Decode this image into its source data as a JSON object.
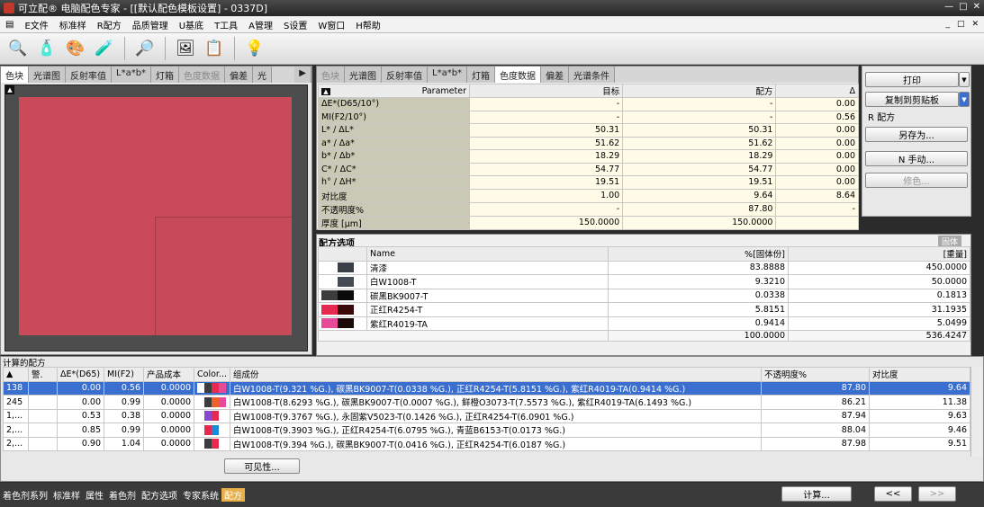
{
  "window": {
    "title": "可立配® 电脑配色专家 - [[默认配色模板设置] - 0337D]",
    "controls": [
      "—",
      "□",
      "✕"
    ]
  },
  "menu": {
    "items": [
      "E文件",
      "标准样",
      "R配方",
      "品质管理",
      "U基底",
      "T工具",
      "A管理",
      "S设置",
      "W窗口",
      "H帮助"
    ],
    "mdi": [
      "_",
      "□",
      "✕"
    ]
  },
  "toolbar": {
    "icons": [
      "🔍",
      "🧴",
      "🎨",
      "🧪",
      "🔎",
      "🖼",
      "📋",
      "💡"
    ]
  },
  "left_panel": {
    "tabs": [
      "色块",
      "光谱图",
      "反射率值",
      "L*a*b*",
      "灯箱",
      "色度数据",
      "偏差",
      "光"
    ],
    "active": 0,
    "colors": {
      "target": "#cb4a59",
      "recipe": "#c74a58",
      "background": "#4d4d4d"
    }
  },
  "param_panel": {
    "tabs": [
      "色块",
      "光谱图",
      "反射率值",
      "L*a*b*",
      "灯箱",
      "色度数据",
      "偏差",
      "光谱条件"
    ],
    "active": 5,
    "headers": [
      "Parameter",
      "目标",
      "配方",
      "Δ"
    ],
    "rows": [
      [
        "ΔE*(D65/10°)",
        "-",
        "-",
        "0.00"
      ],
      [
        "MI(F2/10°)",
        "-",
        "-",
        "0.56"
      ],
      [
        "L* / ΔL*",
        "50.31",
        "50.31",
        "0.00"
      ],
      [
        "a* / Δa*",
        "51.62",
        "51.62",
        "0.00"
      ],
      [
        "b* / Δb*",
        "18.29",
        "18.29",
        "0.00"
      ],
      [
        "C* / ΔC*",
        "54.77",
        "54.77",
        "0.00"
      ],
      [
        "h° / ΔH*",
        "19.51",
        "19.51",
        "0.00"
      ],
      [
        "对比度",
        "1.00",
        "9.64",
        "8.64"
      ],
      [
        "不透明度%",
        "-",
        "87.80",
        "-"
      ],
      [
        "厚度 [µm]",
        "150.0000",
        "150.0000",
        ""
      ]
    ]
  },
  "buttons": {
    "print": "打印",
    "copy": "复制到剪贴板",
    "group_label": "R 配方",
    "save_as": "另存为...",
    "manual": "N 手动...",
    "correct": "修色..."
  },
  "recipe": {
    "title": "配方选项",
    "corner_label": "固体",
    "headers": [
      "Name",
      "%[固体份]",
      "[重量]"
    ],
    "rows": [
      {
        "name": "清漆",
        "pct": "83.8888",
        "wt": "450.0000",
        "c1": "#ffffff",
        "c2": "#3a3f48"
      },
      {
        "name": "白W1008-T",
        "pct": "9.3210",
        "wt": "50.0000",
        "c1": "#ffffff",
        "c2": "#444b55"
      },
      {
        "name": "碳黑BK9007-T",
        "pct": "0.0338",
        "wt": "0.1813",
        "c1": "#3c3c3c",
        "c2": "#0a0a0a"
      },
      {
        "name": "正红R4254-T",
        "pct": "5.8151",
        "wt": "31.1935",
        "c1": "#e8294f",
        "c2": "#3a0a0a"
      },
      {
        "name": "紫红R4019-TA",
        "pct": "0.9414",
        "wt": "5.0499",
        "c1": "#e84a9a",
        "c2": "#1a0a0a"
      }
    ],
    "totals": {
      "pct": "100.0000",
      "wt": "536.4247"
    }
  },
  "results": {
    "title": "计算的配方",
    "headers": [
      "▲",
      "警.",
      "ΔE*(D65)",
      "MI(F2)",
      "产品成本",
      "Color...",
      "组成份",
      "不透明度%",
      "对比度"
    ],
    "rows": [
      {
        "id": "138",
        "de": "0.00",
        "mi": "0.56",
        "cost": "0.0000",
        "comp": "白W1008-T(9.321 %G.), 碳黑BK9007-T(0.0338 %G.), 正红R4254-T(5.8151 %G.), 紫红R4019-TA(0.9414 %G.)",
        "op": "87.80",
        "ct": "9.64",
        "colors": [
          "#ffffff",
          "#3c3c3c",
          "#e8294f",
          "#e84a9a"
        ],
        "selected": true
      },
      {
        "id": "245",
        "de": "0.00",
        "mi": "0.99",
        "cost": "0.0000",
        "comp": "白W1008-T(8.6293 %G.), 碳黑BK9007-T(0.0007 %G.), 鲜橙O3073-T(7.5573 %G.), 紫红R4019-TA(6.1493 %G.)",
        "op": "86.21",
        "ct": "11.38",
        "colors": [
          "#ffffff",
          "#3c3c3c",
          "#f0602a",
          "#e84a9a"
        ],
        "selected": false
      },
      {
        "id": "1,...",
        "de": "0.53",
        "mi": "0.38",
        "cost": "0.0000",
        "comp": "白W1008-T(9.3767 %G.), 永固紫V5023-T(0.1426 %G.), 正红R4254-T(6.0901 %G.)",
        "op": "87.94",
        "ct": "9.63",
        "colors": [
          "#ffffff",
          "#8a4ad0",
          "#e8294f"
        ],
        "selected": false
      },
      {
        "id": "2,...",
        "de": "0.85",
        "mi": "0.99",
        "cost": "0.0000",
        "comp": "白W1008-T(9.3903 %G.), 正红R4254-T(6.0795 %G.), 青蓝B6153-T(0.0173 %G.)",
        "op": "88.04",
        "ct": "9.46",
        "colors": [
          "#ffffff",
          "#e8294f",
          "#1a8ad8"
        ],
        "selected": false
      },
      {
        "id": "2,...",
        "de": "0.90",
        "mi": "1.04",
        "cost": "0.0000",
        "comp": "白W1008-T(9.394 %G.), 碳黑BK9007-T(0.0416 %G.), 正红R4254-T(6.0187 %G.)",
        "op": "87.98",
        "ct": "9.51",
        "colors": [
          "#ffffff",
          "#3c3c3c",
          "#e8294f"
        ],
        "selected": false
      }
    ],
    "visible_button": "可见性..."
  },
  "bottom": {
    "items": [
      "着色剂系列",
      "标准样",
      "属性",
      "着色剂",
      "配方选项",
      "专家系统",
      "配方"
    ],
    "active": 6,
    "calc": "计算...",
    "prev": "<<",
    "next": ">>"
  }
}
